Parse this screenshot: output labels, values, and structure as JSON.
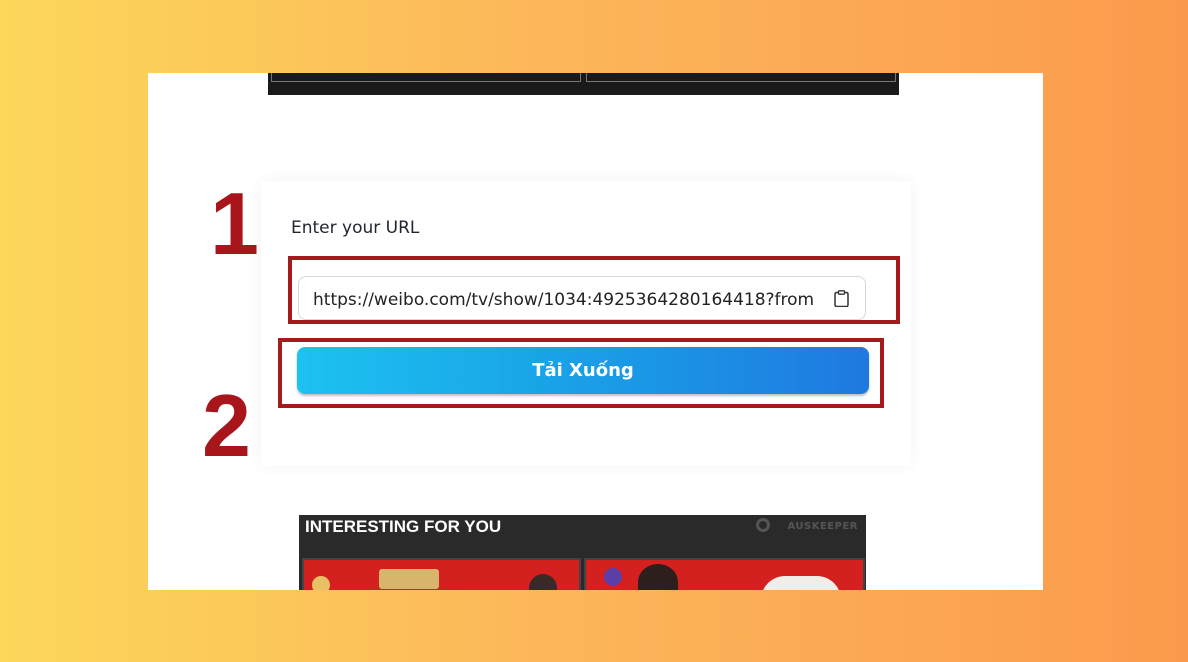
{
  "form": {
    "title": "Enter your URL",
    "url_value": "https://weibo.com/tv/show/1034:4925364280164418?from",
    "button_label": "Tải Xuống"
  },
  "annotations": {
    "step1": "1",
    "step2": "2",
    "highlight_color": "#a51a1a"
  },
  "ad": {
    "title": "INTERESTING FOR YOU",
    "brand": "AUSKEEPER"
  },
  "colors": {
    "button_start": "#1cc2f0",
    "button_end": "#1f79e0"
  }
}
